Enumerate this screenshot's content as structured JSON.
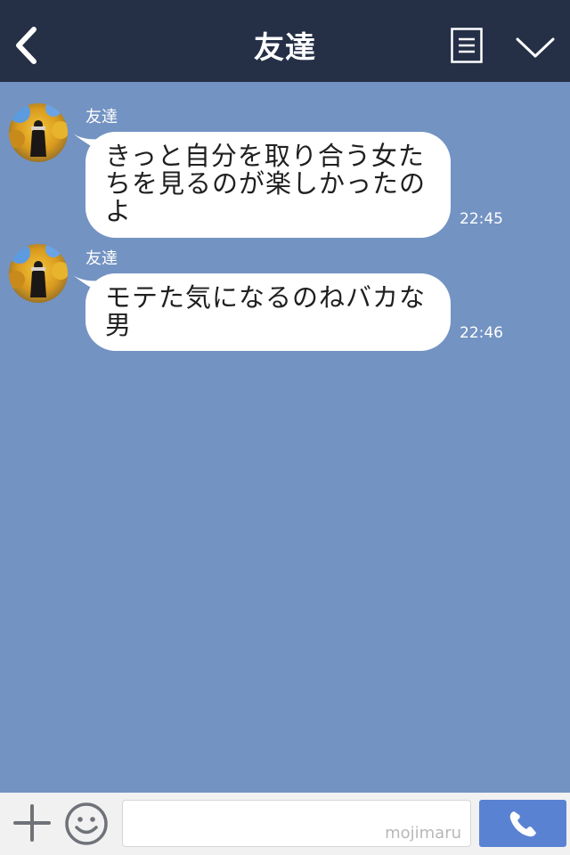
{
  "header": {
    "title": "友達",
    "back_icon": "chevron-left-icon",
    "menu_icon": "list-icon",
    "collapse_icon": "chevron-down-icon"
  },
  "messages": [
    {
      "sender": "友達",
      "text": "きっと自分を取り合う女たちを見るのが楽しかったのよ",
      "time": "22:45"
    },
    {
      "sender": "友達",
      "text": "モテた気になるのねバカな男",
      "time": "22:46"
    }
  ],
  "input": {
    "placeholder": "",
    "watermark": "mojimaru"
  },
  "bottom_bar": {
    "plus_icon": "plus-icon",
    "emoji_icon": "smiley-icon",
    "call_icon": "phone-icon"
  },
  "colors": {
    "header_bg": "#253047",
    "chat_bg": "#7393c2",
    "bubble_bg": "#ffffff",
    "call_button": "#5a82d3",
    "bottom_bar_bg": "#f1f1f1"
  }
}
